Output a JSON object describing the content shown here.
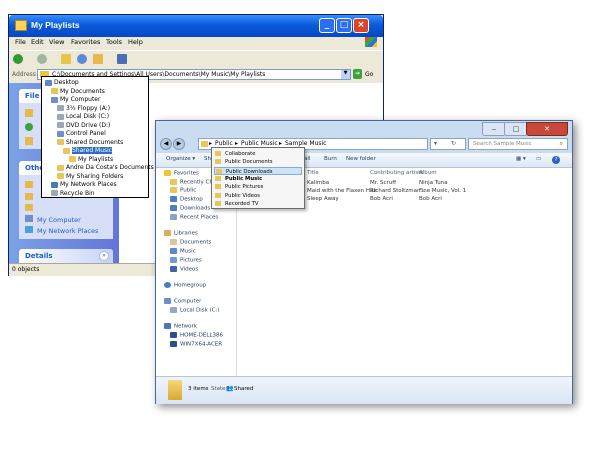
{
  "xp": {
    "title": "My Playlists",
    "menu": [
      "File",
      "Edit",
      "View",
      "Favorites",
      "Tools",
      "Help"
    ],
    "address_label": "Address",
    "address_value": "C:\\Documents and Settings\\All Users\\Documents\\My Music\\My Playlists",
    "go_label": "Go",
    "panels": {
      "file_head": "File",
      "other_head": "Othe",
      "other_links": [
        "My Computer",
        "My Network Places"
      ],
      "details_head": "Details"
    },
    "status": "0 objects",
    "tree": [
      {
        "label": "Desktop",
        "indent": 0,
        "selected": false
      },
      {
        "label": "My Documents",
        "indent": 1,
        "selected": false
      },
      {
        "label": "My Computer",
        "indent": 1,
        "selected": false
      },
      {
        "label": "3½ Floppy (A:)",
        "indent": 2,
        "selected": false
      },
      {
        "label": "Local Disk (C:)",
        "indent": 2,
        "selected": false
      },
      {
        "label": "DVD Drive (D:)",
        "indent": 2,
        "selected": false
      },
      {
        "label": "Control Panel",
        "indent": 2,
        "selected": false
      },
      {
        "label": "Shared Documents",
        "indent": 2,
        "selected": false
      },
      {
        "label": "Shared Music",
        "indent": 3,
        "selected": true
      },
      {
        "label": "My Playlists",
        "indent": 4,
        "selected": false
      },
      {
        "label": "Andre Da Costa's Documents",
        "indent": 2,
        "selected": false
      },
      {
        "label": "My Sharing Folders",
        "indent": 2,
        "selected": false
      },
      {
        "label": "My Network Places",
        "indent": 1,
        "selected": false
      },
      {
        "label": "Recycle Bin",
        "indent": 1,
        "selected": false
      }
    ]
  },
  "w7": {
    "breadcrumb": [
      "Public",
      "Public Music",
      "Sample Music"
    ],
    "search_placeholder": "Search Sample Music",
    "cmd": {
      "organize": "Organize ▾",
      "share": "Sha",
      "play_all": "all",
      "burn": "Burn",
      "new_folder": "New folder"
    },
    "nav": {
      "favorites": "Favorites",
      "fav_items": [
        "Recently Chang",
        "Public",
        "Desktop",
        "Downloads",
        "Recent Places"
      ],
      "libraries": "Libraries",
      "lib_items": [
        "Documents",
        "Music",
        "Pictures",
        "Videos"
      ],
      "homegroup": "Homegroup",
      "computer": "Computer",
      "comp_items": [
        "Local Disk (C:)"
      ],
      "network": "Network",
      "net_items": [
        "HOME-DELL386",
        "WIN7X64-ACER"
      ]
    },
    "columns": [
      "Title",
      "Contributing artists",
      "Album"
    ],
    "rows": [
      {
        "title": "Kalimba",
        "artist": "Mr. Scruff",
        "album": "Ninja Tuna"
      },
      {
        "title": "Maid with the Flaxen Hair",
        "artist": "Richard Stoltzman...",
        "album": "Fine Music, Vol. 1"
      },
      {
        "title": "Sleep Away",
        "artist": "Bob Acri",
        "album": "Bob Acri"
      }
    ],
    "details": {
      "count": "3 items",
      "state_label": "State:",
      "state_value": "Shared"
    },
    "dropdown": [
      {
        "label": "Collaborate",
        "bold": false,
        "highlight": false
      },
      {
        "label": "Public Documents",
        "bold": false,
        "highlight": false
      },
      {
        "label": "Public Downloads",
        "bold": false,
        "highlight": true
      },
      {
        "label": "Public Music",
        "bold": true,
        "highlight": false
      },
      {
        "label": "Public Pictures",
        "bold": false,
        "highlight": false
      },
      {
        "label": "Public Videos",
        "bold": false,
        "highlight": false
      },
      {
        "label": "Recorded TV",
        "bold": false,
        "highlight": false
      }
    ]
  },
  "colors": {
    "xp_title": "#0a5bd8",
    "xp_pane": "#6375d6",
    "w7_frame": "#c9dcf1",
    "selection": "#316ac5"
  }
}
